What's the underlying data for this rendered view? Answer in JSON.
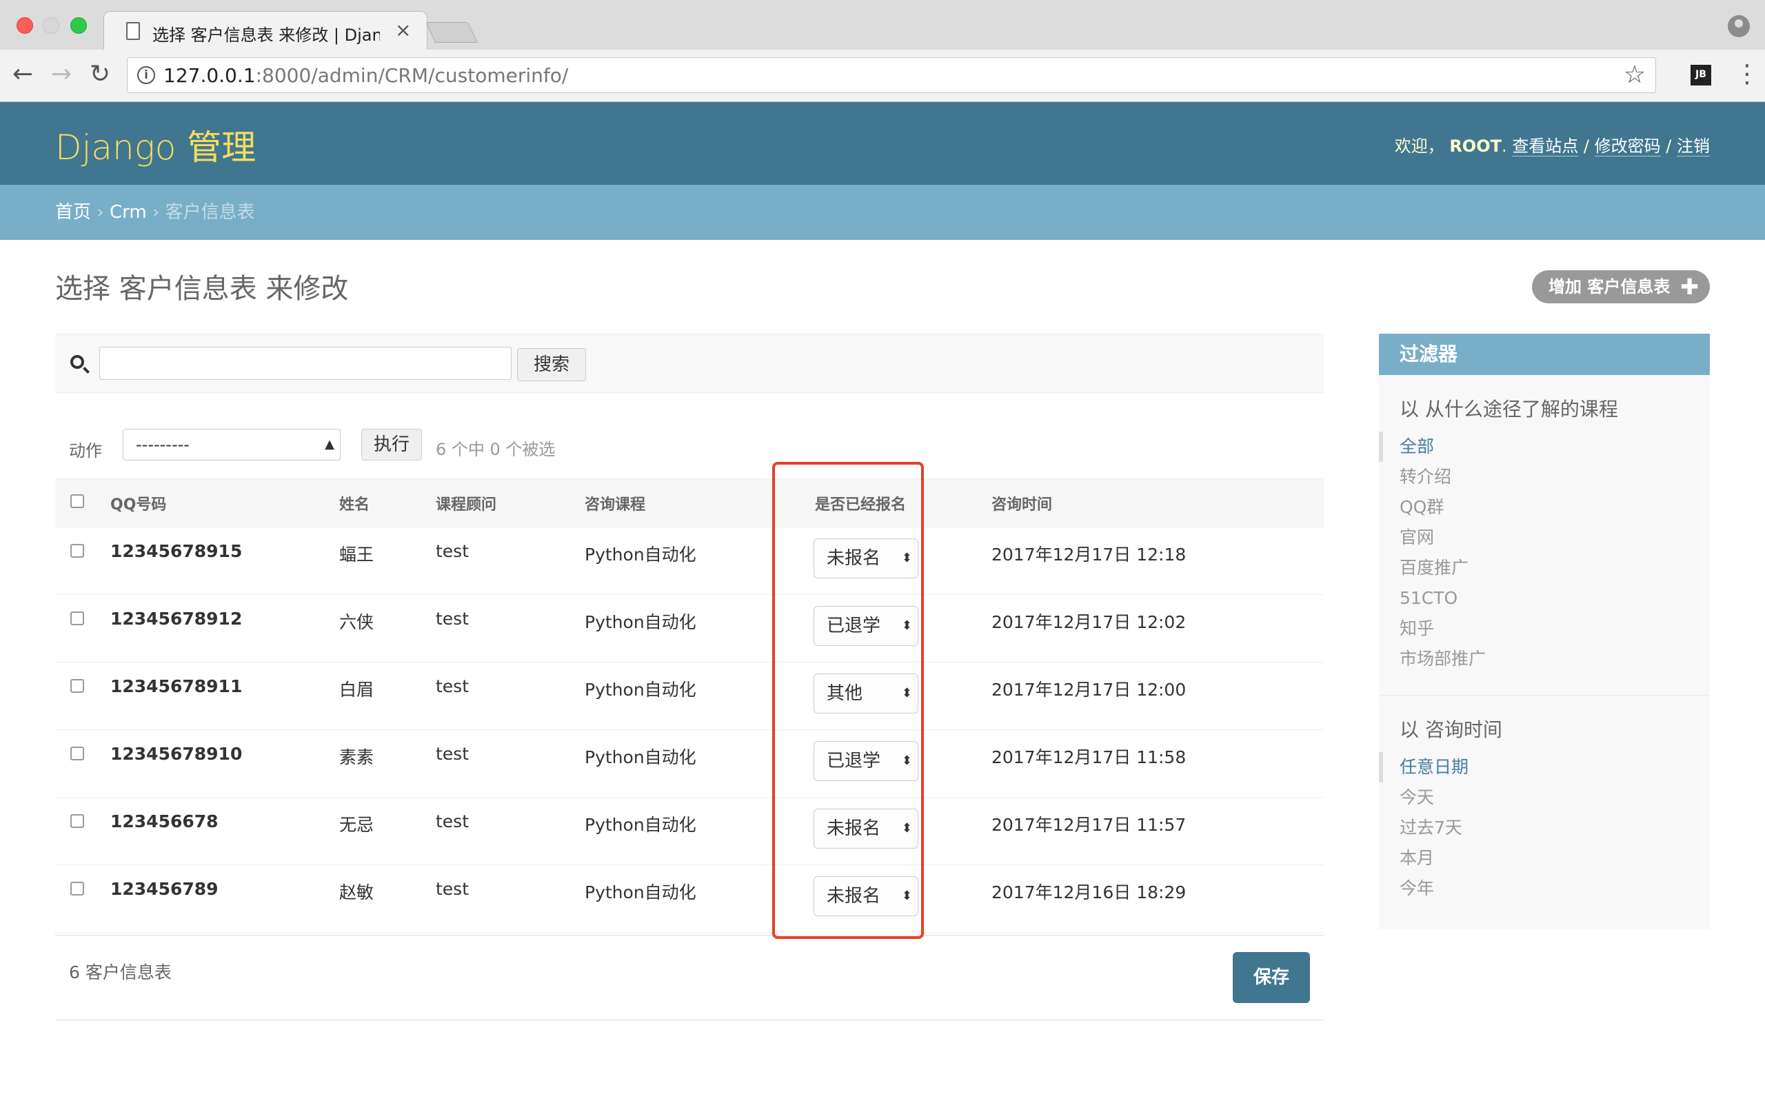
{
  "browser": {
    "tab_title": "选择 客户信息表 来修改 | Django",
    "url_host": "127.0.0.1",
    "url_rest": ":8000/admin/CRM/customerinfo/",
    "ext_label": "JB"
  },
  "header": {
    "brand": "Django 管理",
    "welcome": "欢迎，",
    "username": "ROOT",
    "view_site": "查看站点",
    "change_password": "修改密码",
    "logout": "注销",
    "sep": "/"
  },
  "breadcrumbs": {
    "home": "首页",
    "app": "Crm",
    "model": "客户信息表",
    "sep": "›"
  },
  "page": {
    "title": "选择 客户信息表 来修改",
    "add_button": "增加 客户信息表",
    "add_plus": "✚"
  },
  "search": {
    "placeholder": "",
    "button": "搜索"
  },
  "actions": {
    "label": "动作",
    "selected": "---------",
    "go": "执行",
    "counter": "6 个中 0 个被选"
  },
  "table": {
    "headers": [
      "QQ号码",
      "姓名",
      "课程顾问",
      "咨询课程",
      "是否已经报名",
      "咨询时间"
    ],
    "rows": [
      {
        "qq": "12345678915",
        "name": "蝠王",
        "consultant": "test",
        "course": "Python自动化",
        "status": "未报名",
        "time": "2017年12月17日 12:18"
      },
      {
        "qq": "12345678912",
        "name": "六侠",
        "consultant": "test",
        "course": "Python自动化",
        "status": "已退学",
        "time": "2017年12月17日 12:02"
      },
      {
        "qq": "12345678911",
        "name": "白眉",
        "consultant": "test",
        "course": "Python自动化",
        "status": "其他",
        "time": "2017年12月17日 12:00"
      },
      {
        "qq": "12345678910",
        "name": "素素",
        "consultant": "test",
        "course": "Python自动化",
        "status": "已退学",
        "time": "2017年12月17日 11:58"
      },
      {
        "qq": "123456678",
        "name": "无忌",
        "consultant": "test",
        "course": "Python自动化",
        "status": "未报名",
        "time": "2017年12月17日 11:57"
      },
      {
        "qq": "123456789",
        "name": "赵敏",
        "consultant": "test",
        "course": "Python自动化",
        "status": "未报名",
        "time": "2017年12月16日 18:29"
      }
    ]
  },
  "paginator": {
    "count": "6 客户信息表",
    "save": "保存"
  },
  "filter": {
    "title": "过滤器",
    "groups": [
      {
        "title": "以 从什么途径了解的课程",
        "items": [
          "全部",
          "转介绍",
          "QQ群",
          "官网",
          "百度推广",
          "51CTO",
          "知乎",
          "市场部推广"
        ]
      },
      {
        "title": "以 咨询时间",
        "items": [
          "任意日期",
          "今天",
          "过去7天",
          "本月",
          "今年"
        ]
      }
    ]
  },
  "colors": {
    "header_bg": "#417690",
    "breadcrumb_bg": "#79aec8",
    "brand": "#f5dd5d",
    "link": "#447e9b",
    "highlight": "#e64027"
  }
}
